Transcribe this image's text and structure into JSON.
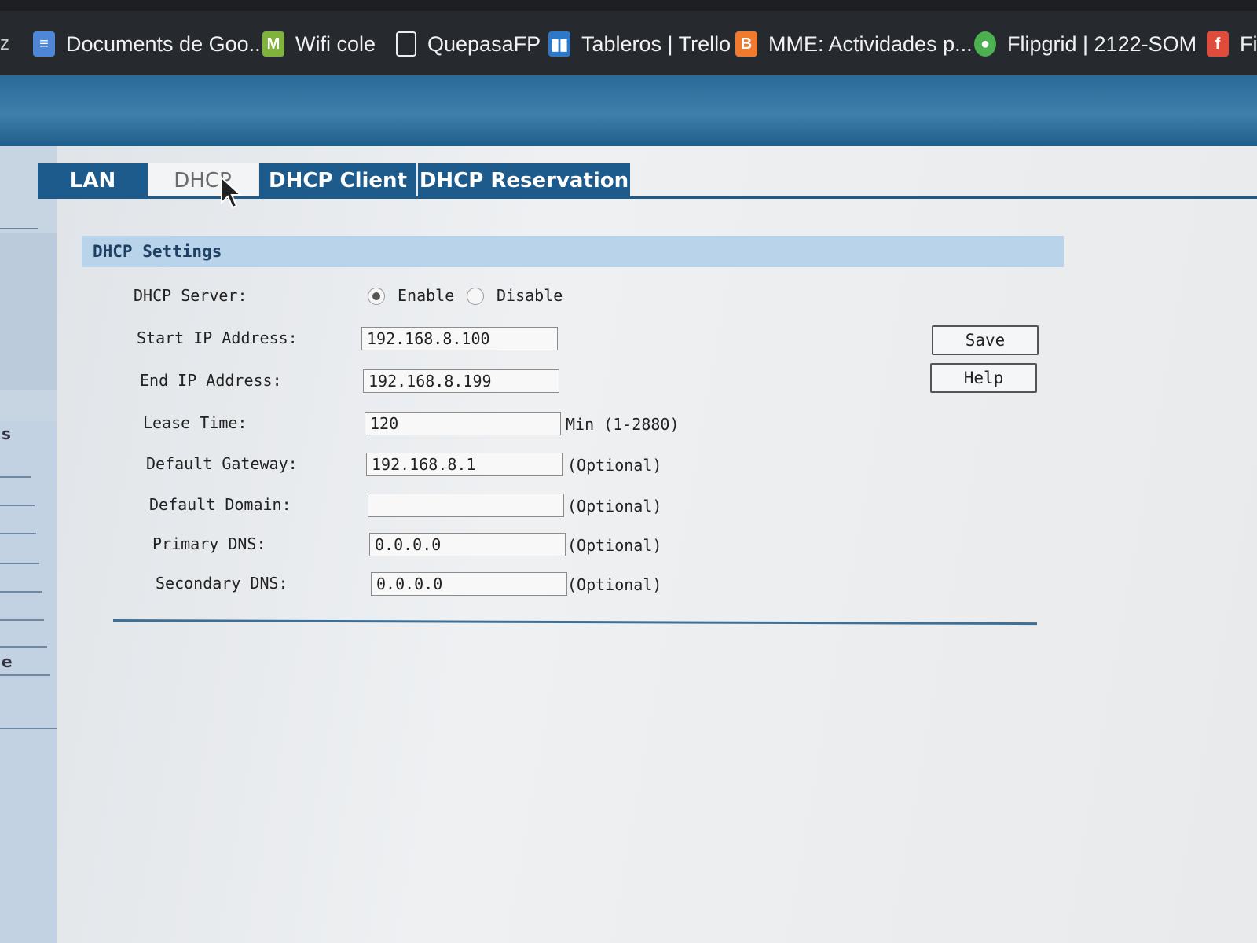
{
  "bookmarks": [
    {
      "label": "Documents de Goo...",
      "icon": "google-docs-icon",
      "color": "#4f86d6"
    },
    {
      "label": "Wifi cole",
      "icon": "gmail-icon",
      "color": "#7fb33b"
    },
    {
      "label": "QuepasaFP",
      "icon": "page-icon",
      "color": "#26292d"
    },
    {
      "label": "Tableros | Trello",
      "icon": "trello-icon",
      "color": "#2e78c8"
    },
    {
      "label": "MME: Actividades p...",
      "icon": "blogger-icon",
      "color": "#f07a2e"
    },
    {
      "label": "Flipgrid | 2122-SOM",
      "icon": "flipgrid-icon",
      "color": "#4caf50"
    },
    {
      "label": "Fi",
      "icon": "figma-icon",
      "color": "#e04c3c"
    }
  ],
  "tabs": [
    {
      "label": "LAN",
      "active": false
    },
    {
      "label": "DHCP",
      "active": true
    },
    {
      "label": "DHCP Client",
      "active": false
    },
    {
      "label": "DHCP Reservation",
      "active": false
    }
  ],
  "section_title": "DHCP Settings",
  "dhcp_server": {
    "label": "DHCP Server:",
    "enable_label": "Enable",
    "disable_label": "Disable",
    "selected": "Enable"
  },
  "fields": {
    "start_ip": {
      "label": "Start IP Address:",
      "value": "192.168.8.100",
      "note": ""
    },
    "end_ip": {
      "label": "End IP Address:",
      "value": "192.168.8.199",
      "note": ""
    },
    "lease_time": {
      "label": "Lease Time:",
      "value": "120",
      "note": "Min (1-2880)"
    },
    "default_gateway": {
      "label": "Default Gateway:",
      "value": "192.168.8.1",
      "note": "(Optional)"
    },
    "default_domain": {
      "label": "Default Domain:",
      "value": "",
      "note": "(Optional)"
    },
    "primary_dns": {
      "label": "Primary DNS:",
      "value": "0.0.0.0",
      "note": "(Optional)"
    },
    "secondary_dns": {
      "label": "Secondary DNS:",
      "value": "0.0.0.0",
      "note": "(Optional)"
    }
  },
  "buttons": {
    "save": "Save",
    "help": "Help"
  },
  "side_menu": {
    "text_a": "s",
    "text_b": "e"
  },
  "colors": {
    "header_blue": "#2a6a98",
    "tab_blue": "#1d5b8d",
    "section_bg": "#b8d3ea"
  }
}
